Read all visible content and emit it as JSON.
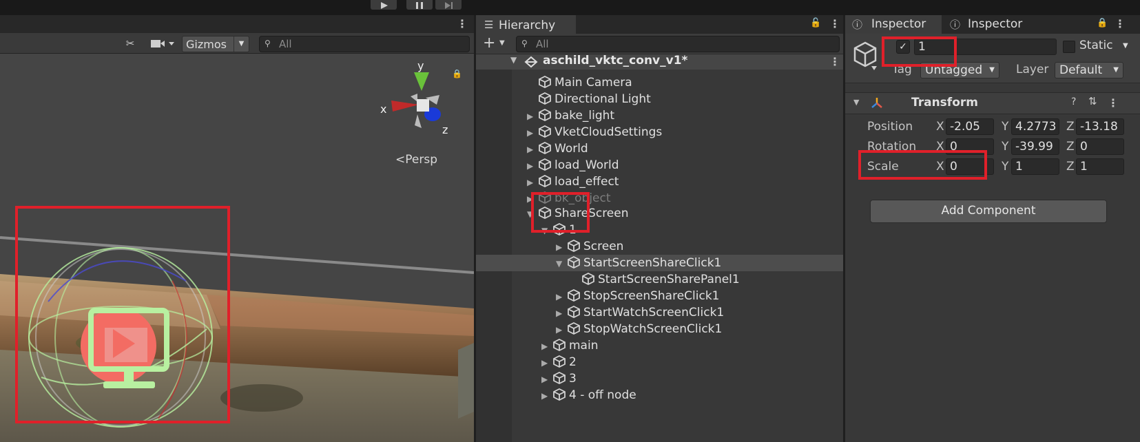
{
  "scene": {
    "gizmos_label": "Gizmos",
    "search_placeholder": "All",
    "axes": {
      "y": "y",
      "x": "x",
      "z": "z"
    },
    "persp_label": "Persp"
  },
  "hierarchy": {
    "tab_label": "Hierarchy",
    "search_placeholder": "All",
    "scene_name": "aschild_vktc_conv_v1*",
    "items": [
      {
        "label": "Main Camera"
      },
      {
        "label": "Directional Light"
      },
      {
        "label": "bake_light"
      },
      {
        "label": "VketCloudSettings"
      },
      {
        "label": "World"
      },
      {
        "label": "load_World"
      },
      {
        "label": "load_effect"
      },
      {
        "label": "bk_object"
      },
      {
        "label": "ShareScreen"
      },
      {
        "label": "1"
      },
      {
        "label": "Screen"
      },
      {
        "label": "StartScreenShareClick1"
      },
      {
        "label": "StartScreenSharePanel1"
      },
      {
        "label": "StopScreenShareClick1"
      },
      {
        "label": "StartWatchScreenClick1"
      },
      {
        "label": "StopWatchScreenClick1"
      },
      {
        "label": "main"
      },
      {
        "label": "2"
      },
      {
        "label": "3"
      },
      {
        "label": "4 - off node"
      }
    ]
  },
  "inspector": {
    "tabs": [
      {
        "label": "Inspector"
      },
      {
        "label": "Inspector"
      }
    ],
    "object_name": "1",
    "static_label": "Static",
    "tag_label": "Tag",
    "tag_value": "Untagged",
    "layer_label": "Layer",
    "layer_value": "Default",
    "transform": {
      "title": "Transform",
      "position": {
        "label": "Position",
        "x": "-2.05",
        "y": "4.2773",
        "z": "-13.18"
      },
      "rotation": {
        "label": "Rotation",
        "x": "0",
        "y": "-39.99",
        "z": "0"
      },
      "scale": {
        "label": "Scale",
        "x": "0",
        "y": "1",
        "z": "1"
      },
      "axis_labels": {
        "x": "X",
        "y": "Y",
        "z": "Z"
      }
    },
    "add_component_label": "Add Component"
  },
  "colors": {
    "highlight_box": "#e0202a",
    "selection_row": "#4d4d4d",
    "monitor_icon": "#b8f0a0",
    "bubble": "#f36c63"
  }
}
